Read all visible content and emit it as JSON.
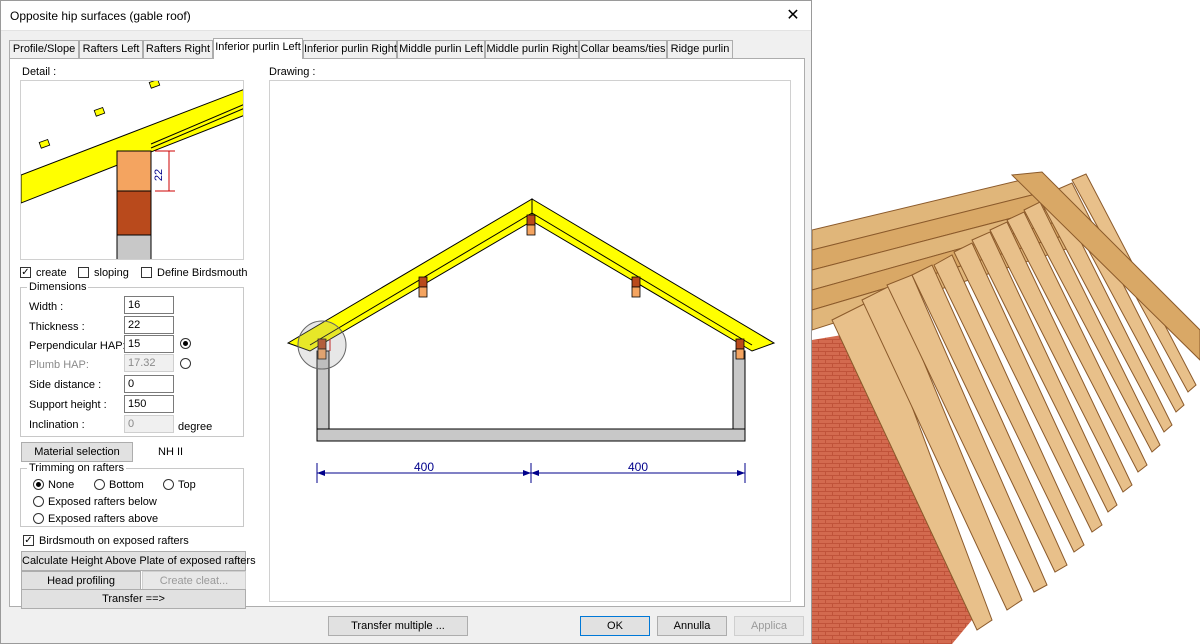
{
  "window": {
    "title": "Opposite hip surfaces (gable roof)"
  },
  "tabs": [
    {
      "label": "Profile/Slope"
    },
    {
      "label": "Rafters Left"
    },
    {
      "label": "Rafters Right"
    },
    {
      "label": "Inferior purlin Left",
      "active": true
    },
    {
      "label": "Inferior purlin Right"
    },
    {
      "label": "Middle purlin Left"
    },
    {
      "label": "Middle purlin Right"
    },
    {
      "label": "Collar beams/ties"
    },
    {
      "label": "Ridge purlin"
    }
  ],
  "detail": {
    "label": "Detail :",
    "dimension_value": "22"
  },
  "options": {
    "create": "create",
    "sloping": "sloping",
    "define_birdsmouth": "Define Birdsmouth"
  },
  "dimensions": {
    "title": "Dimensions",
    "width_label": "Width :",
    "width_value": "16",
    "thickness_label": "Thickness :",
    "thickness_value": "22",
    "perp_hap_label": "Perpendicular HAP:",
    "perp_hap_value": "15",
    "plumb_hap_label": "Plumb HAP:",
    "plumb_hap_value": "17.32",
    "side_distance_label": "Side distance :",
    "side_distance_value": "0",
    "support_height_label": "Support height :",
    "support_height_value": "150",
    "inclination_label": "Inclination :",
    "inclination_value": "0",
    "inclination_unit": "degree"
  },
  "material": {
    "button": "Material selection",
    "value": "NH II"
  },
  "trimming": {
    "title": "Trimming on rafters",
    "none": "None",
    "bottom": "Bottom",
    "top": "Top",
    "exposed_below": "Exposed rafters below",
    "exposed_above": "Exposed rafters above"
  },
  "birdsmouth_exposed": "Birdsmouth on exposed rafters",
  "buttons": {
    "calc_hap": "Calculate Height Above Plate of exposed rafters",
    "head_profiling": "Head profiling",
    "create_cleat": "Create cleat...",
    "transfer": "Transfer ==>",
    "transfer_multiple": "Transfer multiple ...",
    "ok": "OK",
    "cancel": "Annulla",
    "apply": "Applica"
  },
  "drawing": {
    "label": "Drawing :",
    "dim_left": "400",
    "dim_right": "400"
  },
  "colors": {
    "rafter": "#ffff00",
    "purlin_top": "#f4a460",
    "purlin_bottom": "#b94a1c",
    "wall": "#c8c8c8",
    "dimension": "#00008b"
  }
}
